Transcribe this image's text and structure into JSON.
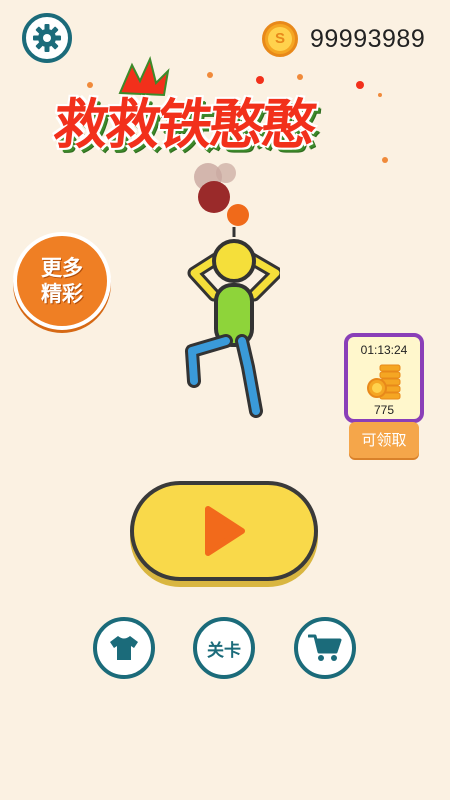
{
  "header": {
    "coin_count": "99993989",
    "coin_symbol": "S"
  },
  "title": "救救铁憨憨",
  "more_games": {
    "line1": "更多",
    "line2": "精彩"
  },
  "reward": {
    "timer": "01:13:24",
    "amount": "775",
    "claim_label": "可领取"
  },
  "nav": {
    "level_label": "关卡"
  },
  "icons": {
    "settings": "gear-icon",
    "coin": "coin-icon",
    "play": "play-icon",
    "skin": "shirt-icon",
    "shop": "cart-icon"
  },
  "colors": {
    "background": "#fbf1e2",
    "teal": "#1b6b7a",
    "play_yellow": "#f9d94a",
    "orange": "#ef7f24",
    "title_red": "#f2301b"
  }
}
